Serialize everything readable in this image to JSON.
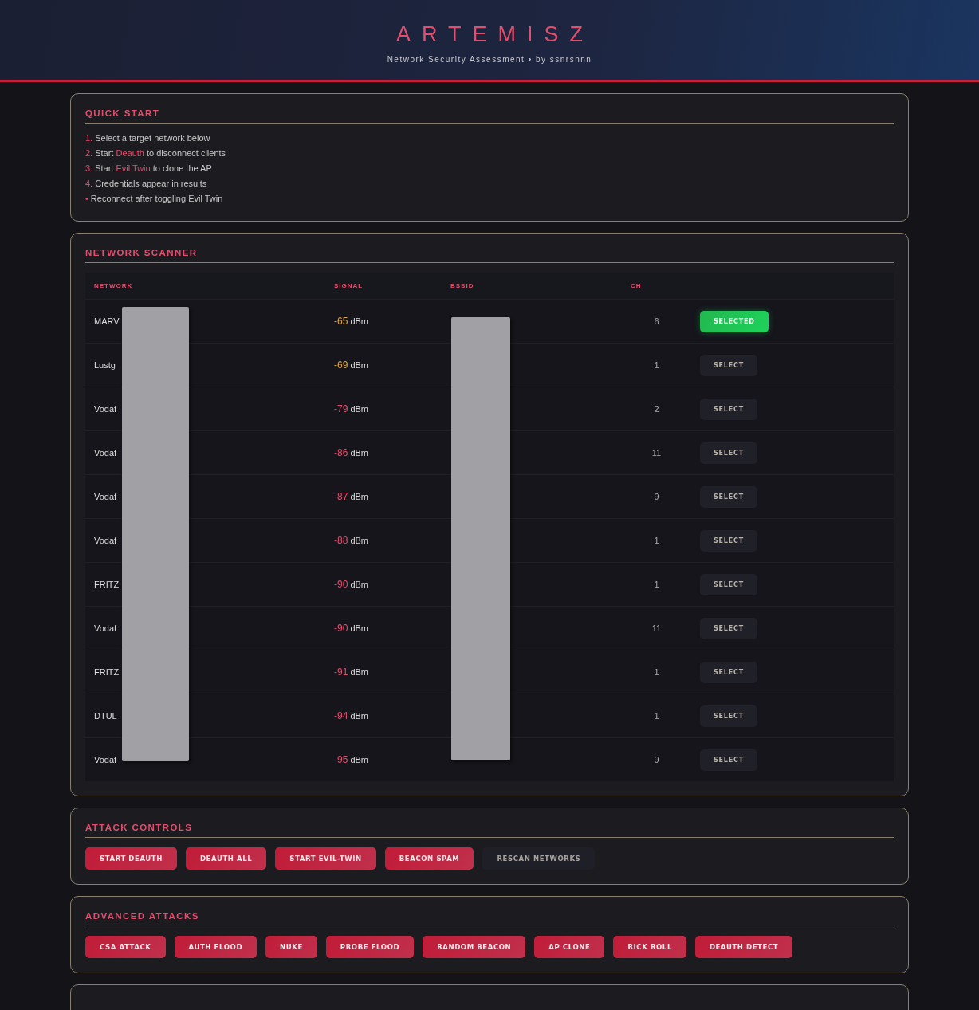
{
  "header": {
    "title": "ARTEMISZ",
    "subtitle": "Network Security Assessment • by ssnrshnn"
  },
  "quick_start": {
    "title": "QUICK START",
    "steps": [
      {
        "marker": "1.",
        "text": "Select a target network below"
      },
      {
        "marker": "2.",
        "text": "Start *Deauth* to disconnect clients"
      },
      {
        "marker": "3.",
        "text": "Start *Evil Twin* to clone the AP"
      },
      {
        "marker": "4.",
        "text": "Credentials appear in results"
      },
      {
        "marker": "•",
        "text": "Reconnect after toggling Evil Twin"
      }
    ]
  },
  "scanner": {
    "title": "NETWORK SCANNER",
    "columns": [
      "NETWORK",
      "SIGNAL",
      "BSSID",
      "CH"
    ],
    "rows": [
      {
        "network": "MARV",
        "signal": "-65",
        "unit": "dBm",
        "color": "#e0a83a",
        "channel": "6",
        "action": "SELECTED",
        "selected": true
      },
      {
        "network": "Lustg",
        "signal": "-69",
        "unit": "dBm",
        "color": "#e0a83a",
        "channel": "1",
        "action": "SELECT",
        "selected": false
      },
      {
        "network": "Vodaf",
        "signal": "-79",
        "unit": "dBm",
        "color": "#e0506e",
        "channel": "2",
        "action": "SELECT",
        "selected": false
      },
      {
        "network": "Vodaf",
        "signal": "-86",
        "unit": "dBm",
        "color": "#e0506e",
        "channel": "11",
        "action": "SELECT",
        "selected": false
      },
      {
        "network": "Vodaf",
        "signal": "-87",
        "unit": "dBm",
        "color": "#e0506e",
        "channel": "9",
        "action": "SELECT",
        "selected": false
      },
      {
        "network": "Vodaf",
        "signal": "-88",
        "unit": "dBm",
        "color": "#e0506e",
        "channel": "1",
        "action": "SELECT",
        "selected": false
      },
      {
        "network": "FRITZ",
        "signal": "-90",
        "unit": "dBm",
        "color": "#e0506e",
        "channel": "1",
        "action": "SELECT",
        "selected": false
      },
      {
        "network": "Vodaf",
        "signal": "-90",
        "unit": "dBm",
        "color": "#e0506e",
        "channel": "11",
        "action": "SELECT",
        "selected": false
      },
      {
        "network": "FRITZ",
        "signal": "-91",
        "unit": "dBm",
        "color": "#e0506e",
        "channel": "1",
        "action": "SELECT",
        "selected": false
      },
      {
        "network": "DTUL",
        "signal": "-94",
        "unit": "dBm",
        "color": "#e0506e",
        "channel": "1",
        "action": "SELECT",
        "selected": false
      },
      {
        "network": "Vodaf",
        "signal": "-95",
        "unit": "dBm",
        "color": "#e0506e",
        "channel": "9",
        "action": "SELECT",
        "selected": false
      }
    ]
  },
  "attack_controls": {
    "title": "ATTACK CONTROLS",
    "buttons": [
      {
        "label": "START DEAUTH",
        "kind": "danger"
      },
      {
        "label": "DEAUTH ALL",
        "kind": "danger"
      },
      {
        "label": "START EVIL-TWIN",
        "kind": "danger"
      },
      {
        "label": "BEACON SPAM",
        "kind": "danger"
      },
      {
        "label": "RESCAN NETWORKS",
        "kind": "neutral"
      }
    ]
  },
  "advanced_attacks": {
    "title": "ADVANCED ATTACKS",
    "buttons": [
      {
        "label": "CSA ATTACK",
        "kind": "danger"
      },
      {
        "label": "AUTH FLOOD",
        "kind": "danger"
      },
      {
        "label": "NUKE",
        "kind": "danger"
      },
      {
        "label": "PROBE FLOOD",
        "kind": "danger"
      },
      {
        "label": "RANDOM BEACON",
        "kind": "danger"
      },
      {
        "label": "AP CLONE",
        "kind": "danger"
      },
      {
        "label": "RICK ROLL",
        "kind": "danger"
      },
      {
        "label": "DEAUTH DETECT",
        "kind": "danger"
      }
    ]
  }
}
